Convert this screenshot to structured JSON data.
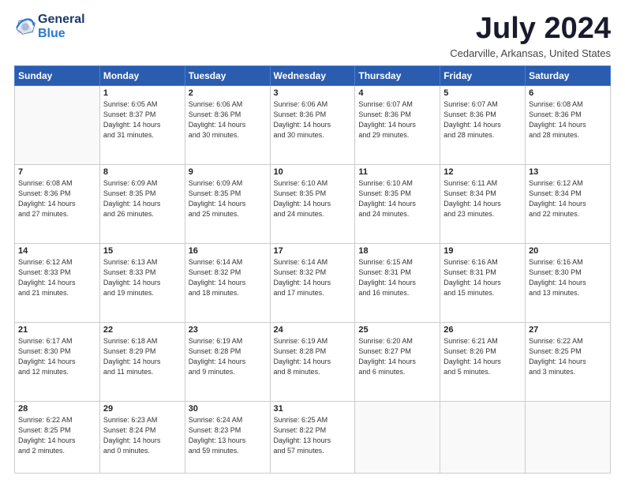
{
  "header": {
    "logo_line1": "General",
    "logo_line2": "Blue",
    "month": "July 2024",
    "location": "Cedarville, Arkansas, United States"
  },
  "days_of_week": [
    "Sunday",
    "Monday",
    "Tuesday",
    "Wednesday",
    "Thursday",
    "Friday",
    "Saturday"
  ],
  "weeks": [
    [
      {
        "day": "",
        "info": ""
      },
      {
        "day": "1",
        "info": "Sunrise: 6:05 AM\nSunset: 8:37 PM\nDaylight: 14 hours\nand 31 minutes."
      },
      {
        "day": "2",
        "info": "Sunrise: 6:06 AM\nSunset: 8:36 PM\nDaylight: 14 hours\nand 30 minutes."
      },
      {
        "day": "3",
        "info": "Sunrise: 6:06 AM\nSunset: 8:36 PM\nDaylight: 14 hours\nand 30 minutes."
      },
      {
        "day": "4",
        "info": "Sunrise: 6:07 AM\nSunset: 8:36 PM\nDaylight: 14 hours\nand 29 minutes."
      },
      {
        "day": "5",
        "info": "Sunrise: 6:07 AM\nSunset: 8:36 PM\nDaylight: 14 hours\nand 28 minutes."
      },
      {
        "day": "6",
        "info": "Sunrise: 6:08 AM\nSunset: 8:36 PM\nDaylight: 14 hours\nand 28 minutes."
      }
    ],
    [
      {
        "day": "7",
        "info": "Sunrise: 6:08 AM\nSunset: 8:36 PM\nDaylight: 14 hours\nand 27 minutes."
      },
      {
        "day": "8",
        "info": "Sunrise: 6:09 AM\nSunset: 8:35 PM\nDaylight: 14 hours\nand 26 minutes."
      },
      {
        "day": "9",
        "info": "Sunrise: 6:09 AM\nSunset: 8:35 PM\nDaylight: 14 hours\nand 25 minutes."
      },
      {
        "day": "10",
        "info": "Sunrise: 6:10 AM\nSunset: 8:35 PM\nDaylight: 14 hours\nand 24 minutes."
      },
      {
        "day": "11",
        "info": "Sunrise: 6:10 AM\nSunset: 8:35 PM\nDaylight: 14 hours\nand 24 minutes."
      },
      {
        "day": "12",
        "info": "Sunrise: 6:11 AM\nSunset: 8:34 PM\nDaylight: 14 hours\nand 23 minutes."
      },
      {
        "day": "13",
        "info": "Sunrise: 6:12 AM\nSunset: 8:34 PM\nDaylight: 14 hours\nand 22 minutes."
      }
    ],
    [
      {
        "day": "14",
        "info": "Sunrise: 6:12 AM\nSunset: 8:33 PM\nDaylight: 14 hours\nand 21 minutes."
      },
      {
        "day": "15",
        "info": "Sunrise: 6:13 AM\nSunset: 8:33 PM\nDaylight: 14 hours\nand 19 minutes."
      },
      {
        "day": "16",
        "info": "Sunrise: 6:14 AM\nSunset: 8:32 PM\nDaylight: 14 hours\nand 18 minutes."
      },
      {
        "day": "17",
        "info": "Sunrise: 6:14 AM\nSunset: 8:32 PM\nDaylight: 14 hours\nand 17 minutes."
      },
      {
        "day": "18",
        "info": "Sunrise: 6:15 AM\nSunset: 8:31 PM\nDaylight: 14 hours\nand 16 minutes."
      },
      {
        "day": "19",
        "info": "Sunrise: 6:16 AM\nSunset: 8:31 PM\nDaylight: 14 hours\nand 15 minutes."
      },
      {
        "day": "20",
        "info": "Sunrise: 6:16 AM\nSunset: 8:30 PM\nDaylight: 14 hours\nand 13 minutes."
      }
    ],
    [
      {
        "day": "21",
        "info": "Sunrise: 6:17 AM\nSunset: 8:30 PM\nDaylight: 14 hours\nand 12 minutes."
      },
      {
        "day": "22",
        "info": "Sunrise: 6:18 AM\nSunset: 8:29 PM\nDaylight: 14 hours\nand 11 minutes."
      },
      {
        "day": "23",
        "info": "Sunrise: 6:19 AM\nSunset: 8:28 PM\nDaylight: 14 hours\nand 9 minutes."
      },
      {
        "day": "24",
        "info": "Sunrise: 6:19 AM\nSunset: 8:28 PM\nDaylight: 14 hours\nand 8 minutes."
      },
      {
        "day": "25",
        "info": "Sunrise: 6:20 AM\nSunset: 8:27 PM\nDaylight: 14 hours\nand 6 minutes."
      },
      {
        "day": "26",
        "info": "Sunrise: 6:21 AM\nSunset: 8:26 PM\nDaylight: 14 hours\nand 5 minutes."
      },
      {
        "day": "27",
        "info": "Sunrise: 6:22 AM\nSunset: 8:25 PM\nDaylight: 14 hours\nand 3 minutes."
      }
    ],
    [
      {
        "day": "28",
        "info": "Sunrise: 6:22 AM\nSunset: 8:25 PM\nDaylight: 14 hours\nand 2 minutes."
      },
      {
        "day": "29",
        "info": "Sunrise: 6:23 AM\nSunset: 8:24 PM\nDaylight: 14 hours\nand 0 minutes."
      },
      {
        "day": "30",
        "info": "Sunrise: 6:24 AM\nSunset: 8:23 PM\nDaylight: 13 hours\nand 59 minutes."
      },
      {
        "day": "31",
        "info": "Sunrise: 6:25 AM\nSunset: 8:22 PM\nDaylight: 13 hours\nand 57 minutes."
      },
      {
        "day": "",
        "info": ""
      },
      {
        "day": "",
        "info": ""
      },
      {
        "day": "",
        "info": ""
      }
    ]
  ]
}
